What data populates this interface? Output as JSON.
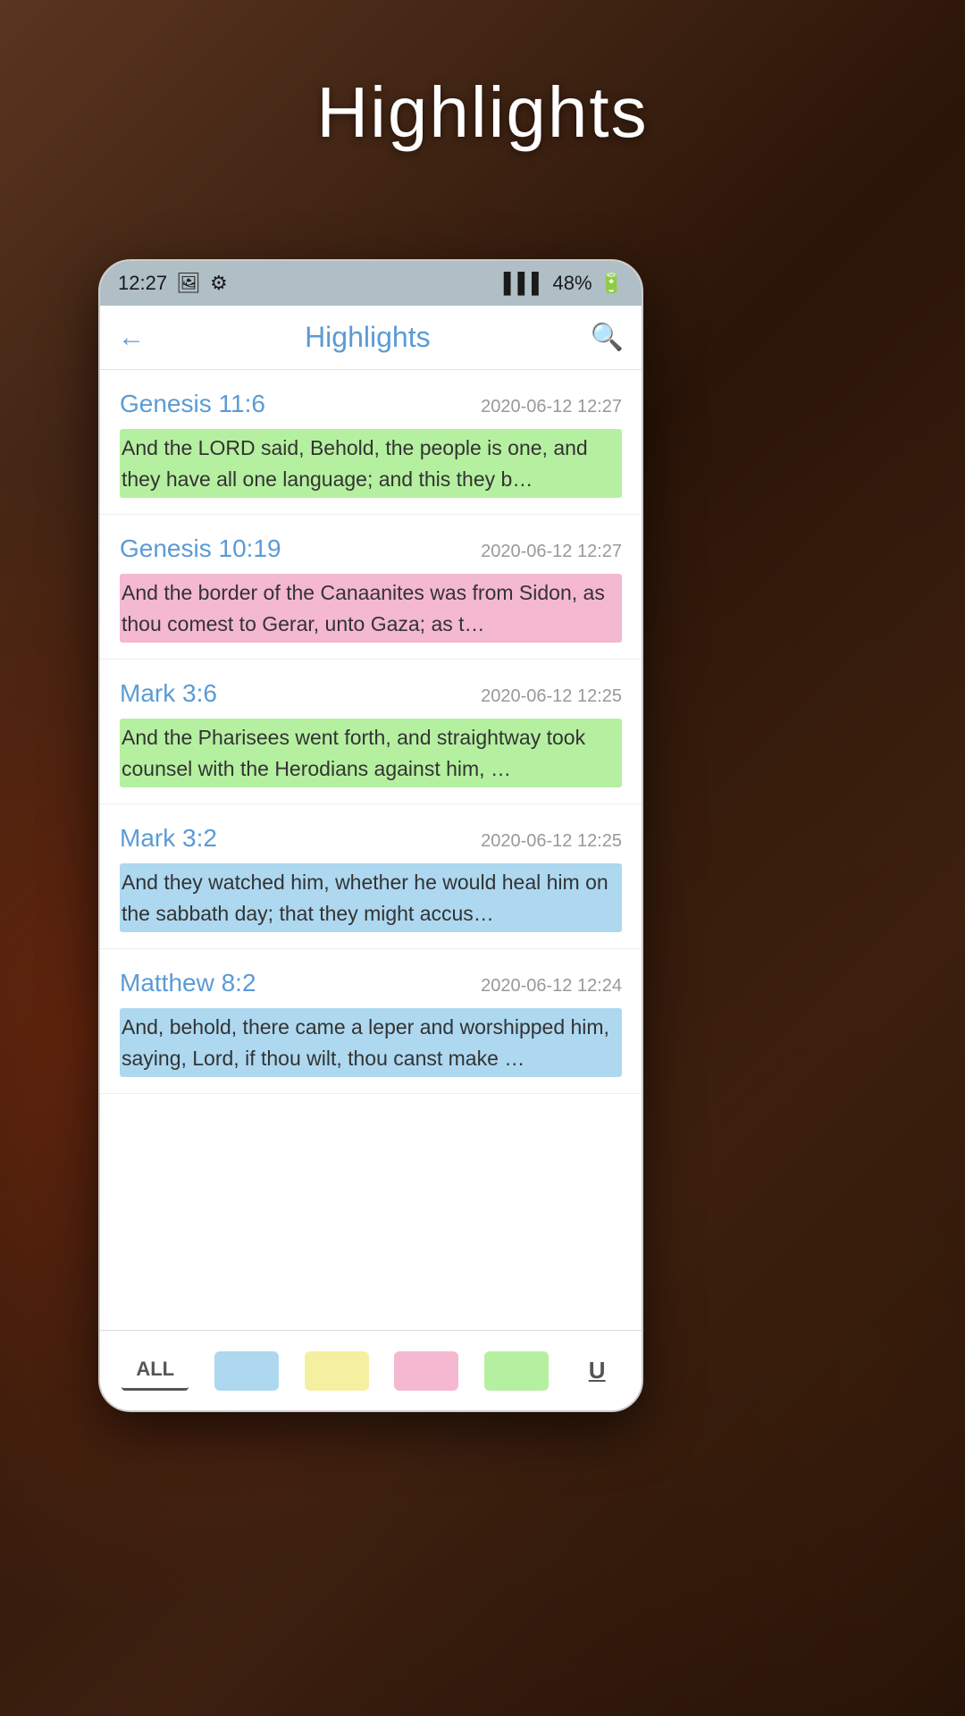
{
  "page": {
    "title": "Highlights",
    "background_color": "#3a2010"
  },
  "status_bar": {
    "time": "12:27",
    "battery": "48%",
    "signal": "▌▌▌",
    "icons": [
      "image-icon",
      "bluetooth-icon"
    ]
  },
  "header": {
    "title": "Highlights",
    "back_label": "←",
    "search_label": "🔍"
  },
  "highlights": [
    {
      "reference": "Genesis 11:6",
      "date": "2020-06-12 12:27",
      "text": "And the LORD said, Behold, the people is one, and they have all one language; and this they b…",
      "highlight_color": "green"
    },
    {
      "reference": "Genesis 10:19",
      "date": "2020-06-12 12:27",
      "text": "And the border of the Canaanites was from Sidon, as thou comest to Gerar, unto Gaza; as t…",
      "highlight_color": "pink"
    },
    {
      "reference": "Mark 3:6",
      "date": "2020-06-12 12:25",
      "text": "And the Pharisees went forth, and straightway took counsel with the Herodians against him, …",
      "highlight_color": "green"
    },
    {
      "reference": "Mark 3:2",
      "date": "2020-06-12 12:25",
      "text": "And they watched him, whether he would heal him on the sabbath day; that they might accus…",
      "highlight_color": "blue"
    },
    {
      "reference": "Matthew 8:2",
      "date": "2020-06-12 12:24",
      "text": "And, behold, there came a leper and worshipped him, saying, Lord, if thou wilt, thou canst make …",
      "highlight_color": "blue"
    }
  ],
  "filter_bar": {
    "all_label": "ALL",
    "underline_label": "U",
    "colors": [
      {
        "name": "blue",
        "hex": "#add8f0"
      },
      {
        "name": "yellow",
        "hex": "#f5f0a0"
      },
      {
        "name": "pink",
        "hex": "#f4b8d0"
      },
      {
        "name": "green",
        "hex": "#b5f0a0"
      }
    ]
  }
}
